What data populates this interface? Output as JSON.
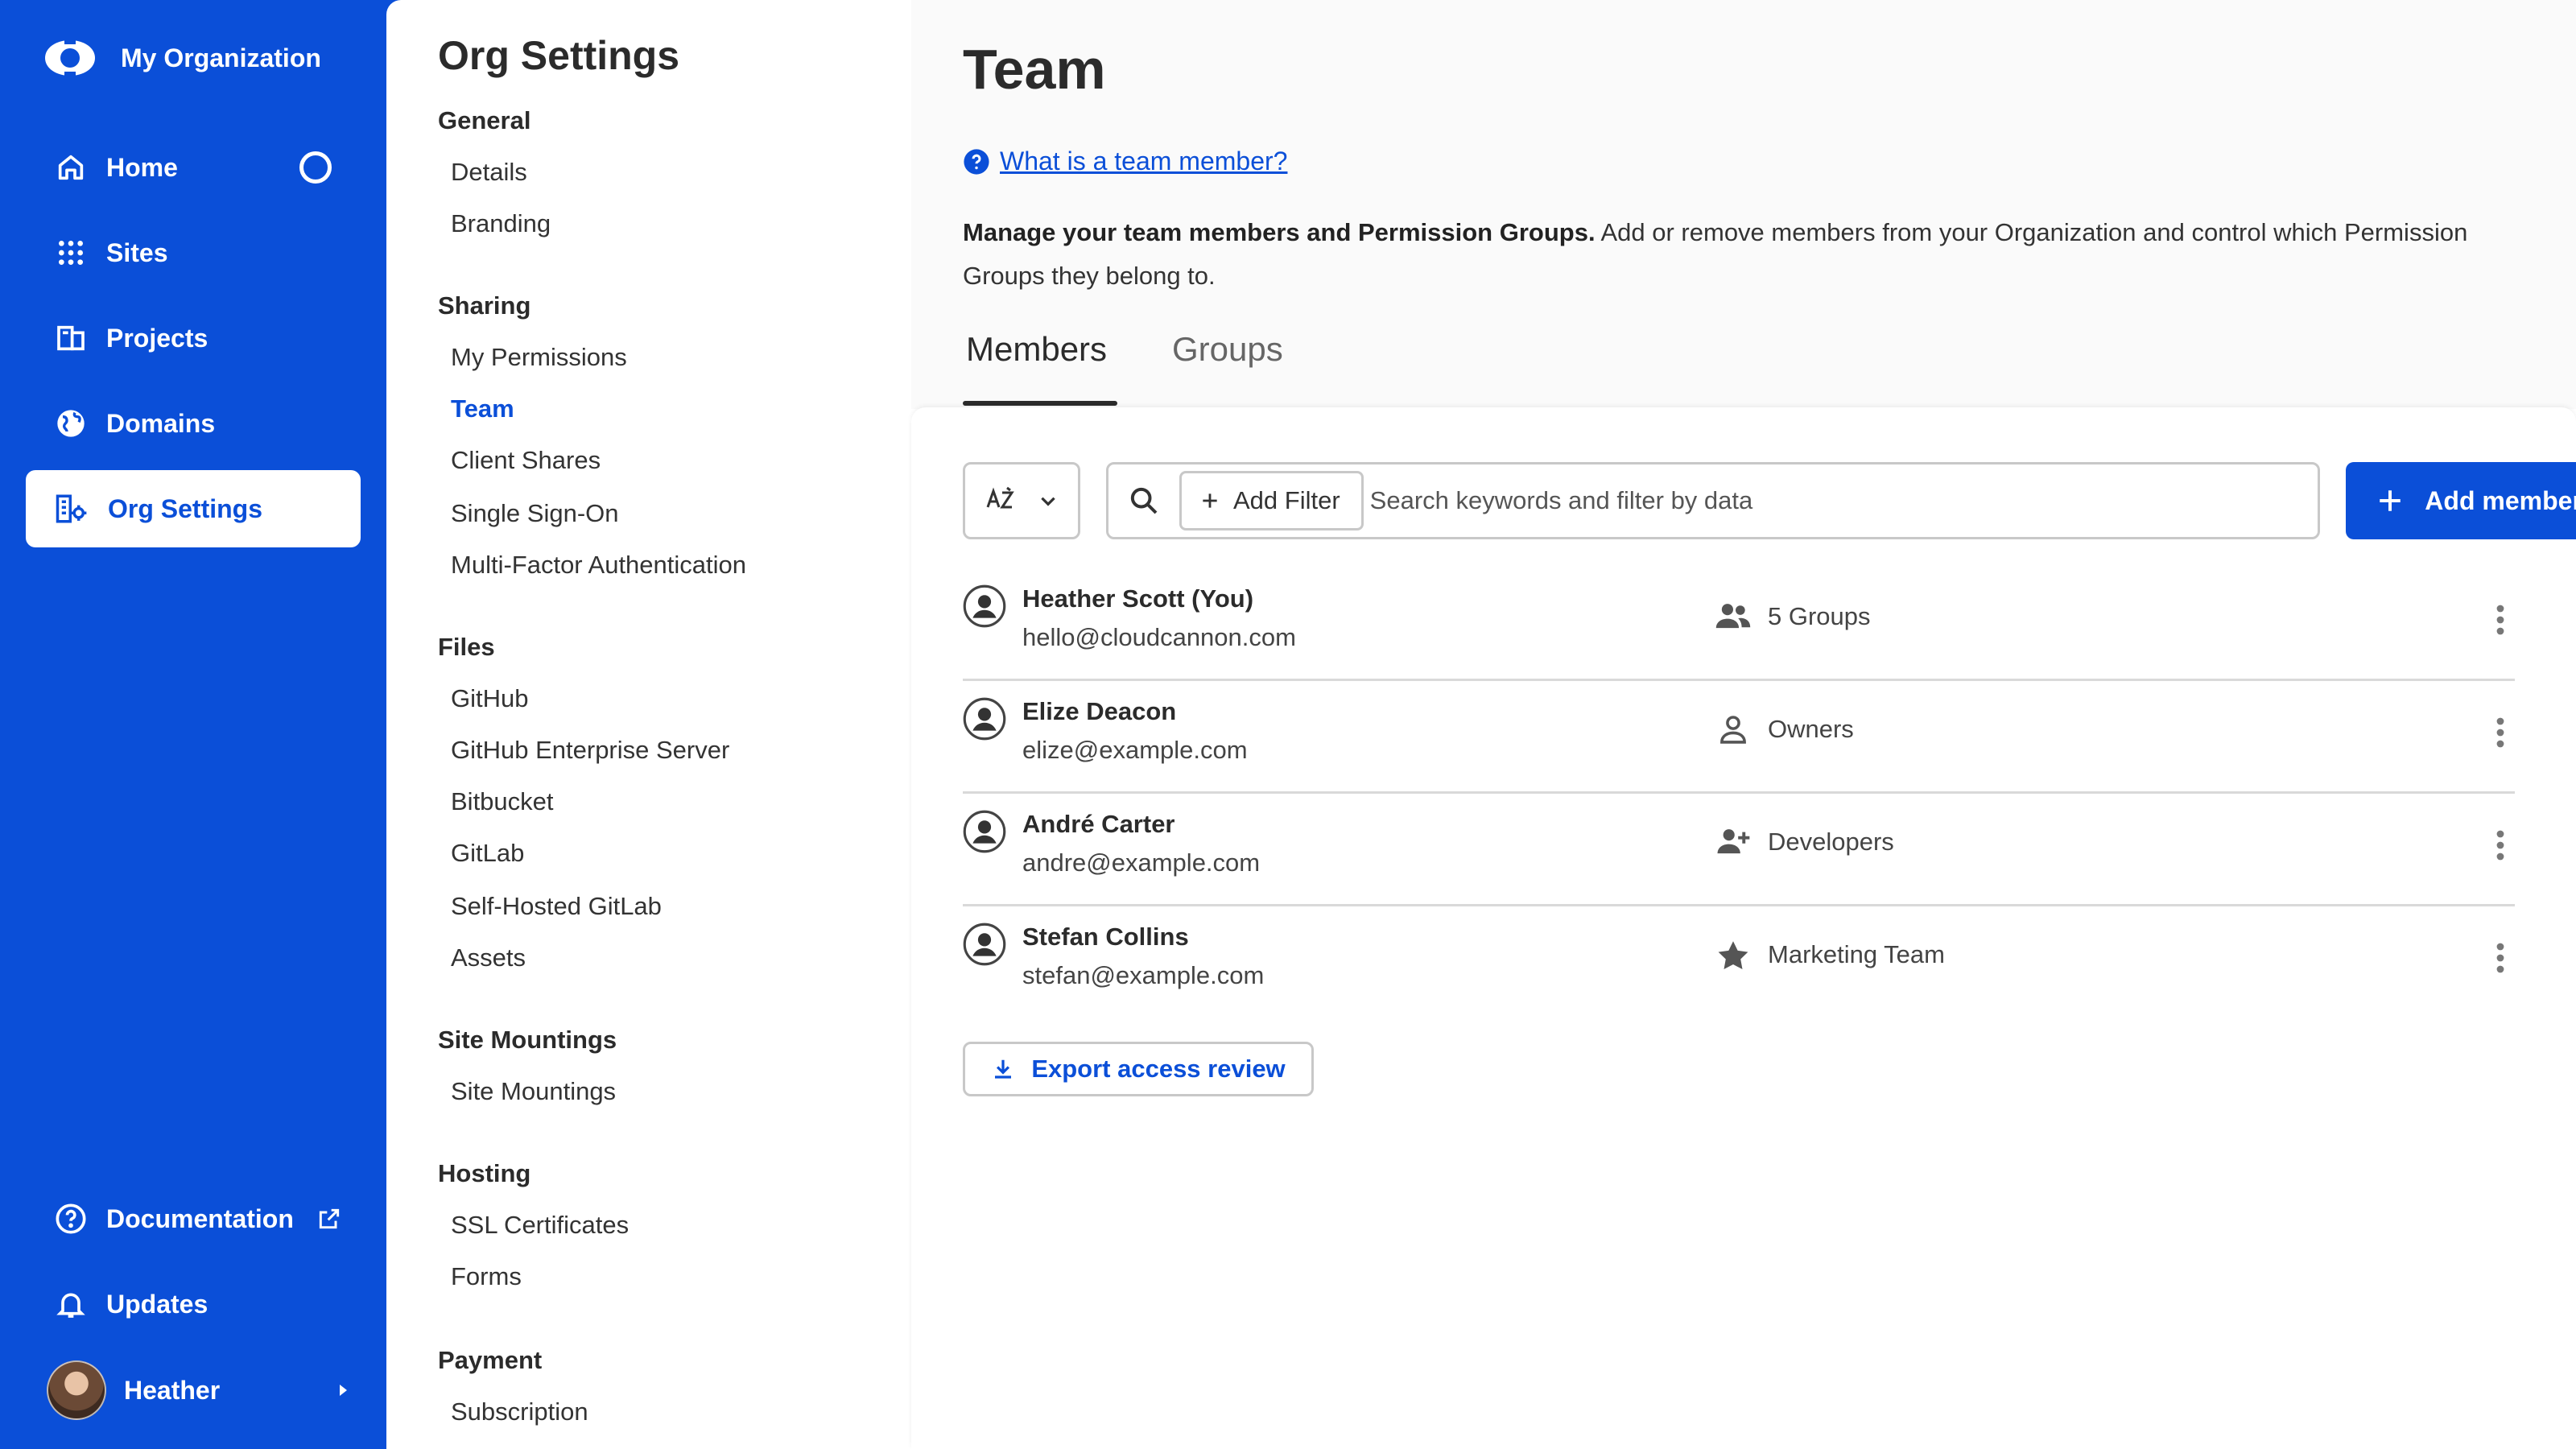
{
  "nav": {
    "org_name": "My Organization",
    "items": [
      {
        "label": "Home",
        "icon": "home-icon"
      },
      {
        "label": "Sites",
        "icon": "grid-icon"
      },
      {
        "label": "Projects",
        "icon": "projects-icon"
      },
      {
        "label": "Domains",
        "icon": "globe-icon"
      },
      {
        "label": "Org Settings",
        "icon": "org-settings-icon"
      }
    ],
    "bottom": [
      {
        "label": "Documentation",
        "icon": "help-circle-icon"
      },
      {
        "label": "Updates",
        "icon": "bell-icon"
      }
    ],
    "user_name": "Heather"
  },
  "settings": {
    "title": "Org Settings",
    "sections": [
      {
        "heading": "General",
        "links": [
          "Details",
          "Branding"
        ]
      },
      {
        "heading": "Sharing",
        "links": [
          "My Permissions",
          "Team",
          "Client Shares",
          "Single Sign-On",
          "Multi-Factor Authentication"
        ]
      },
      {
        "heading": "Files",
        "links": [
          "GitHub",
          "GitHub Enterprise Server",
          "Bitbucket",
          "GitLab",
          "Self-Hosted GitLab",
          "Assets"
        ]
      },
      {
        "heading": "Site Mountings",
        "links": [
          "Site Mountings"
        ]
      },
      {
        "heading": "Hosting",
        "links": [
          "SSL Certificates",
          "Forms"
        ]
      },
      {
        "heading": "Payment",
        "links": [
          "Subscription"
        ]
      }
    ],
    "active_link": "Team"
  },
  "main": {
    "title": "Team",
    "help_link": "What is a team member?",
    "desc_bold": "Manage your team members and Permission Groups.",
    "desc_rest": " Add or remove members from your Organization and control which Permission Groups they belong to.",
    "tabs": [
      {
        "label": "Members",
        "active": true
      },
      {
        "label": "Groups",
        "active": false
      }
    ],
    "add_filter_label": "Add Filter",
    "search_placeholder": "Search keywords and filter by data",
    "add_members_label": "Add members",
    "members": [
      {
        "name": "Heather Scott (You)",
        "email": "hello@cloudcannon.com",
        "group": "5 Groups",
        "group_icon": "people-icon"
      },
      {
        "name": "Elize Deacon",
        "email": "elize@example.com",
        "group": "Owners",
        "group_icon": "person-outline-icon"
      },
      {
        "name": "André Carter",
        "email": "andre@example.com",
        "group": "Developers",
        "group_icon": "person-add-icon"
      },
      {
        "name": "Stefan Collins",
        "email": "stefan@example.com",
        "group": "Marketing Team",
        "group_icon": "star-icon"
      }
    ],
    "export_label": "Export access review"
  },
  "colors": {
    "brand": "#0b4fd8",
    "text": "#2b2b2b",
    "border": "#c8c8c8"
  }
}
